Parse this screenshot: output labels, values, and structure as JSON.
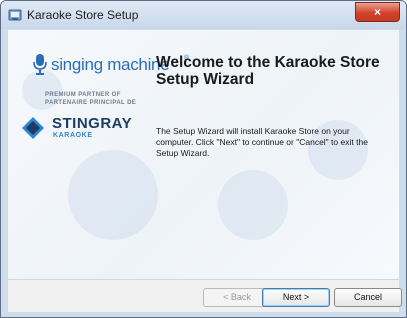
{
  "window": {
    "title": "Karaoke Store Setup",
    "close_glyph": "×",
    "app_icon": "installer-icon"
  },
  "branding": {
    "singing_machine": "singing machine",
    "trademark": "®",
    "partner_line1": "PREMIUM PARTNER OF",
    "partner_line2": "PARTENAIRE PRINCIPAL DE",
    "stingray": "STINGRAY",
    "stingray_sub": "KARAOKE",
    "colors": {
      "singing_machine": "#2a6fb6",
      "stingray": "#1d3b63",
      "stingray_accent": "#2f87cf"
    }
  },
  "content": {
    "headline": "Welcome to the Karaoke Store Setup Wizard",
    "description": "The Setup Wizard will install Karaoke Store on your computer.  Click \"Next\" to continue or \"Cancel\" to exit the Setup Wizard."
  },
  "buttons": {
    "back": "< Back",
    "next": "Next >",
    "cancel": "Cancel"
  }
}
